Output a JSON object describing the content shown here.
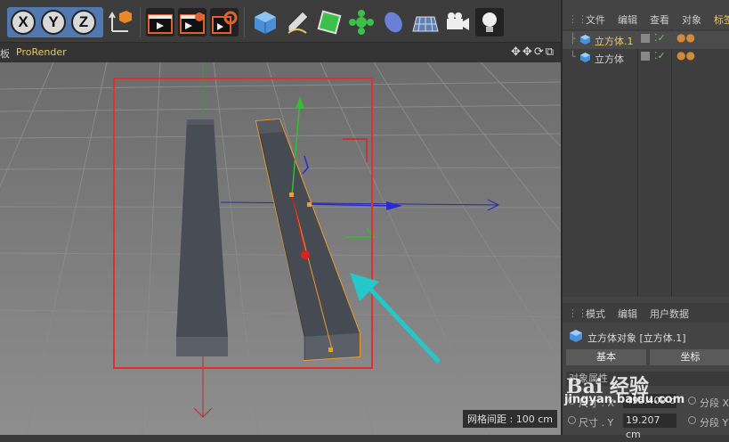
{
  "viewport": {
    "menu_partial": "板",
    "renderer_label": "ProRender",
    "nav_icons": "✥✥⟳⧉",
    "grid_spacing_label": "网格间距 : 100 cm"
  },
  "toolbar": {
    "axis_x": "X",
    "axis_y": "Y",
    "axis_z": "Z"
  },
  "object_manager": {
    "menu": [
      "文件",
      "编辑",
      "查看",
      "对象",
      "标签"
    ],
    "objects": [
      {
        "name": "立方体.1",
        "selected": true
      },
      {
        "name": "立方体",
        "selected": false
      }
    ]
  },
  "attributes": {
    "menu": [
      "模式",
      "编辑",
      "用户数据"
    ],
    "title": "立方体对象 [立方体.1]",
    "tabs": [
      "基本",
      "坐标"
    ],
    "section": "对象属性",
    "rows": [
      {
        "label": "尺寸 . X",
        "value": "495.409 c",
        "right_label": "分段 X"
      },
      {
        "label": "尺寸 . Y",
        "value": "19.207 cm",
        "right_label": "分段 Y"
      }
    ]
  },
  "watermark": {
    "brand": "Bai 经验",
    "url": "jingyan.baidu.com"
  },
  "colors": {
    "accent_yellow": "#e8c869",
    "selection_orange": "#f09a2a",
    "annotation_red": "#e03030",
    "annotation_cyan": "#25c8c8"
  }
}
